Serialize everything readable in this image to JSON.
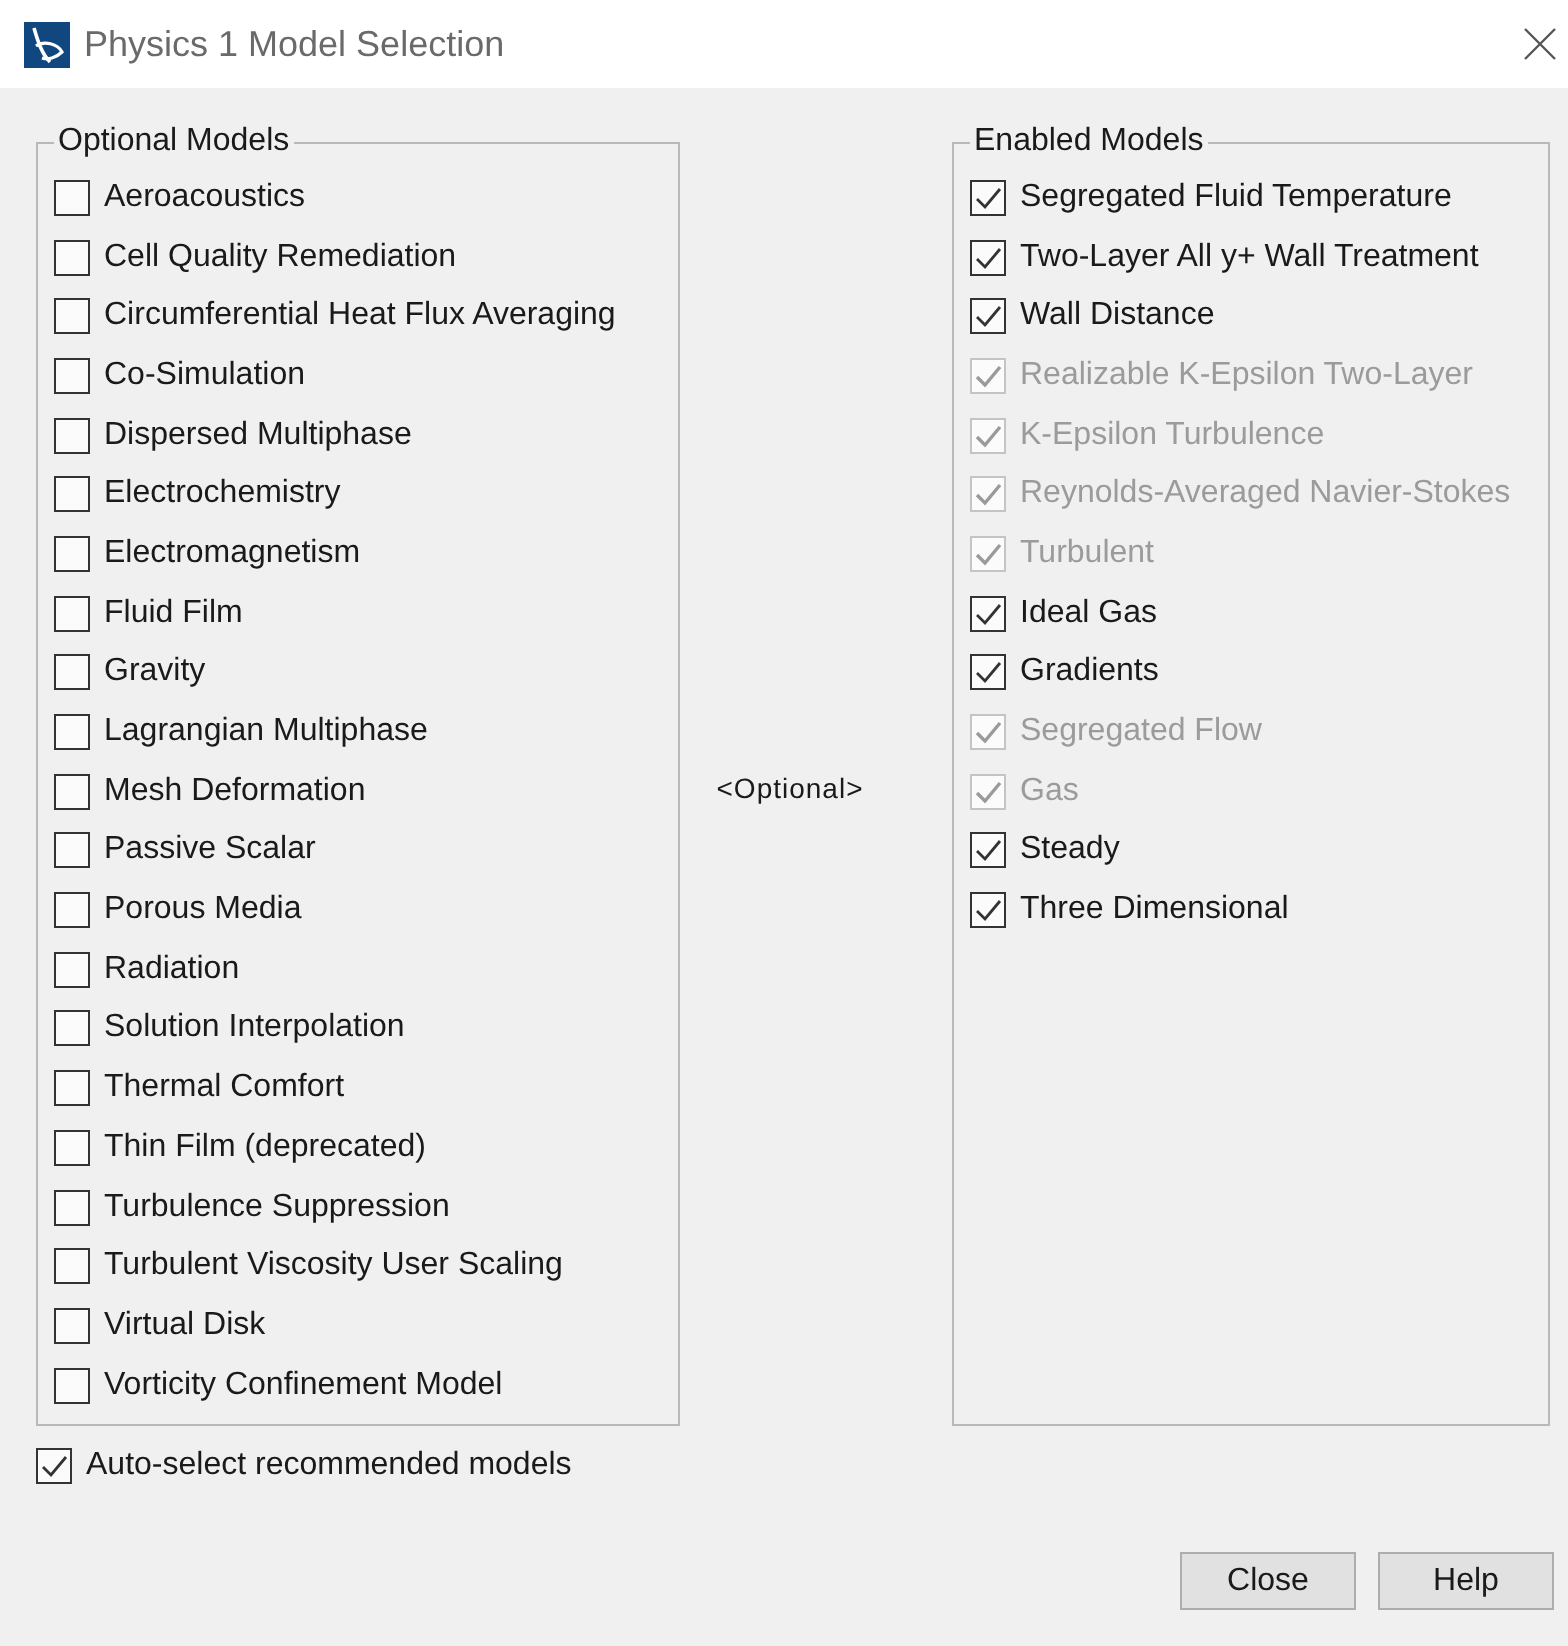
{
  "window": {
    "title": "Physics 1 Model Selection"
  },
  "optional_models": {
    "title": "Optional Models",
    "items": [
      {
        "label": "Aeroacoustics",
        "checked": false,
        "disabled": false
      },
      {
        "label": "Cell Quality Remediation",
        "checked": false,
        "disabled": false
      },
      {
        "label": "Circumferential Heat Flux Averaging",
        "checked": false,
        "disabled": false
      },
      {
        "label": "Co-Simulation",
        "checked": false,
        "disabled": false
      },
      {
        "label": "Dispersed Multiphase",
        "checked": false,
        "disabled": false
      },
      {
        "label": "Electrochemistry",
        "checked": false,
        "disabled": false
      },
      {
        "label": "Electromagnetism",
        "checked": false,
        "disabled": false
      },
      {
        "label": "Fluid Film",
        "checked": false,
        "disabled": false
      },
      {
        "label": "Gravity",
        "checked": false,
        "disabled": false
      },
      {
        "label": "Lagrangian Multiphase",
        "checked": false,
        "disabled": false
      },
      {
        "label": "Mesh Deformation",
        "checked": false,
        "disabled": false
      },
      {
        "label": "Passive Scalar",
        "checked": false,
        "disabled": false
      },
      {
        "label": "Porous Media",
        "checked": false,
        "disabled": false
      },
      {
        "label": "Radiation",
        "checked": false,
        "disabled": false
      },
      {
        "label": "Solution Interpolation",
        "checked": false,
        "disabled": false
      },
      {
        "label": "Thermal Comfort",
        "checked": false,
        "disabled": false
      },
      {
        "label": "Thin Film (deprecated)",
        "checked": false,
        "disabled": false
      },
      {
        "label": "Turbulence Suppression",
        "checked": false,
        "disabled": false
      },
      {
        "label": "Turbulent Viscosity User Scaling",
        "checked": false,
        "disabled": false
      },
      {
        "label": "Virtual Disk",
        "checked": false,
        "disabled": false
      },
      {
        "label": "Vorticity Confinement Model",
        "checked": false,
        "disabled": false
      }
    ]
  },
  "middle_label": "<Optional>",
  "enabled_models": {
    "title": "Enabled Models",
    "items": [
      {
        "label": "Segregated Fluid Temperature",
        "checked": true,
        "disabled": false
      },
      {
        "label": "Two-Layer All y+ Wall Treatment",
        "checked": true,
        "disabled": false
      },
      {
        "label": "Wall Distance",
        "checked": true,
        "disabled": false
      },
      {
        "label": "Realizable K-Epsilon Two-Layer",
        "checked": true,
        "disabled": true
      },
      {
        "label": "K-Epsilon Turbulence",
        "checked": true,
        "disabled": true
      },
      {
        "label": "Reynolds-Averaged Navier-Stokes",
        "checked": true,
        "disabled": true
      },
      {
        "label": "Turbulent",
        "checked": true,
        "disabled": true
      },
      {
        "label": "Ideal Gas",
        "checked": true,
        "disabled": false
      },
      {
        "label": "Gradients",
        "checked": true,
        "disabled": false
      },
      {
        "label": "Segregated Flow",
        "checked": true,
        "disabled": true
      },
      {
        "label": "Gas",
        "checked": true,
        "disabled": true
      },
      {
        "label": "Steady",
        "checked": true,
        "disabled": false
      },
      {
        "label": "Three Dimensional",
        "checked": true,
        "disabled": false
      }
    ]
  },
  "auto_select": {
    "label": "Auto-select recommended models",
    "checked": true
  },
  "buttons": [
    "Close",
    "Help"
  ]
}
